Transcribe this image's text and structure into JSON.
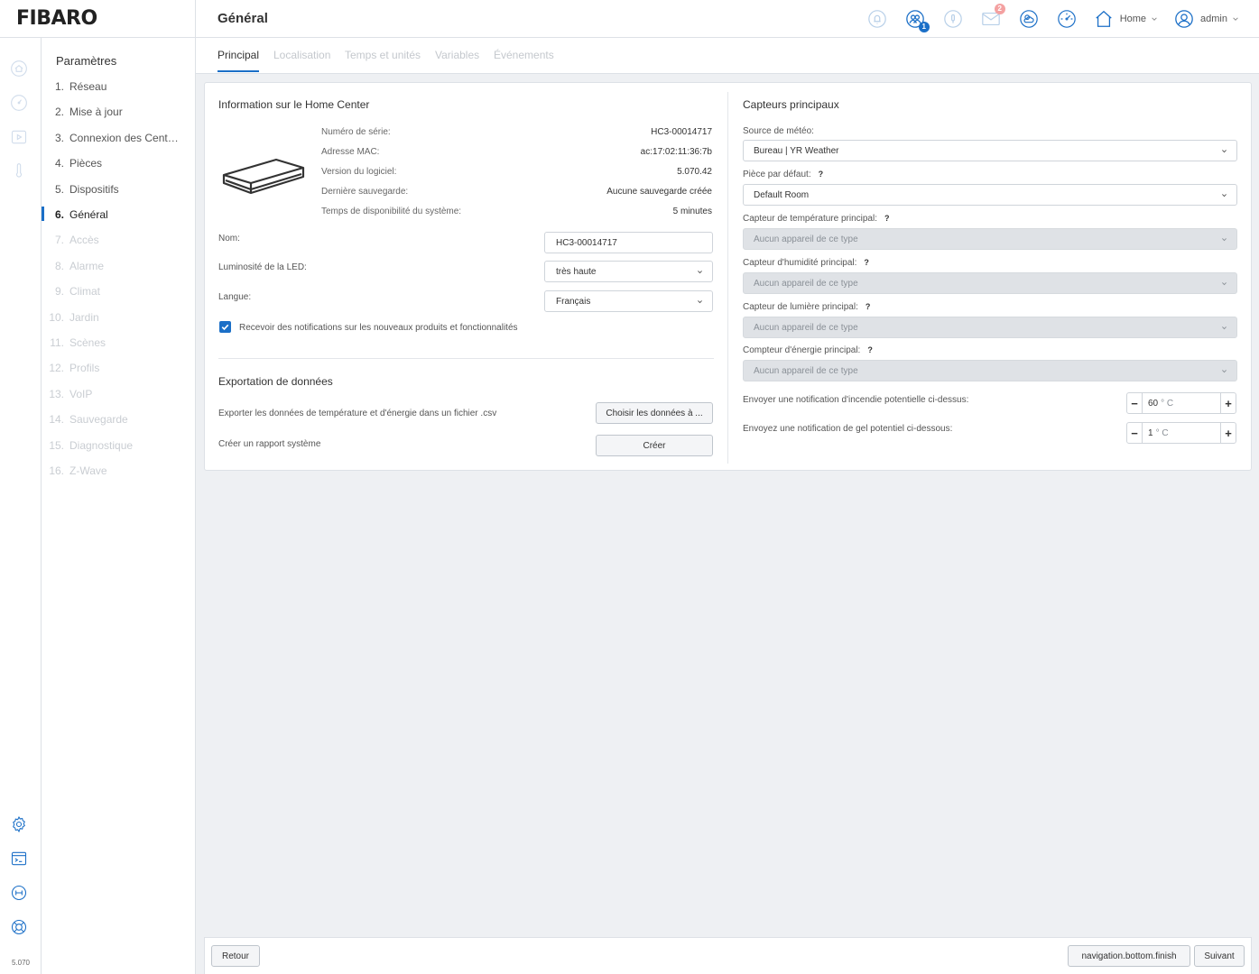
{
  "app": {
    "logo": "FIBARO",
    "version": "5.070"
  },
  "header": {
    "title": "Général",
    "notifications_count": "1",
    "messages_count": "2",
    "home_label": "Home",
    "user_label": "admin"
  },
  "sidebar": {
    "title": "Paramètres",
    "items": [
      {
        "num": "1.",
        "label": "Réseau",
        "state": "enabled"
      },
      {
        "num": "2.",
        "label": "Mise à jour",
        "state": "enabled"
      },
      {
        "num": "3.",
        "label": "Connexion des Centrales",
        "state": "enabled"
      },
      {
        "num": "4.",
        "label": "Pièces",
        "state": "enabled"
      },
      {
        "num": "5.",
        "label": "Dispositifs",
        "state": "enabled"
      },
      {
        "num": "6.",
        "label": "Général",
        "state": "active"
      },
      {
        "num": "7.",
        "label": "Accès",
        "state": "disabled"
      },
      {
        "num": "8.",
        "label": "Alarme",
        "state": "disabled"
      },
      {
        "num": "9.",
        "label": "Climat",
        "state": "disabled"
      },
      {
        "num": "10.",
        "label": "Jardin",
        "state": "disabled"
      },
      {
        "num": "11.",
        "label": "Scènes",
        "state": "disabled"
      },
      {
        "num": "12.",
        "label": "Profils",
        "state": "disabled"
      },
      {
        "num": "13.",
        "label": "VoIP",
        "state": "disabled"
      },
      {
        "num": "14.",
        "label": "Sauvegarde",
        "state": "disabled"
      },
      {
        "num": "15.",
        "label": "Diagnostique",
        "state": "disabled"
      },
      {
        "num": "16.",
        "label": "Z-Wave",
        "state": "disabled"
      }
    ]
  },
  "tabs": [
    {
      "label": "Principal",
      "active": true
    },
    {
      "label": "Localisation",
      "active": false
    },
    {
      "label": "Temps et unités",
      "active": false
    },
    {
      "label": "Variables",
      "active": false
    },
    {
      "label": "Événements",
      "active": false
    }
  ],
  "info": {
    "title": "Information sur le Home Center",
    "rows": [
      {
        "label": "Numéro de série:",
        "value": "HC3-00014717"
      },
      {
        "label": "Adresse MAC:",
        "value": "ac:17:02:11:36:7b"
      },
      {
        "label": "Version du logiciel:",
        "value": "5.070.42"
      },
      {
        "label": "Dernière sauvegarde:",
        "value": "Aucune sauvegarde créée"
      },
      {
        "label": "Temps de disponibilité du système:",
        "value": "5 minutes"
      }
    ]
  },
  "form": {
    "name_label": "Nom:",
    "name_value": "HC3-00014717",
    "led_label": "Luminosité de la LED:",
    "led_value": "très haute",
    "lang_label": "Langue:",
    "lang_value": "Français",
    "notify_label": "Recevoir des notifications sur les nouveaux produits et fonctionnalités",
    "notify_checked": true
  },
  "export": {
    "title": "Exportation de données",
    "csv_label": "Exporter les données de température et d'énergie dans un fichier .csv",
    "csv_button": "Choisir les données à ...",
    "report_label": "Créer un rapport système",
    "report_button": "Créer"
  },
  "sensors": {
    "title": "Capteurs principaux",
    "weather_label": "Source de météo:",
    "weather_value": "Bureau | YR Weather",
    "room_label": "Pièce par défaut:",
    "room_value": "Default Room",
    "temp_label": "Capteur de température principal:",
    "temp_value": "Aucun appareil de ce type",
    "humidity_label": "Capteur d'humidité principal:",
    "humidity_value": "Aucun appareil de ce type",
    "light_label": "Capteur de lumière principal:",
    "light_value": "Aucun appareil de ce type",
    "energy_label": "Compteur d'énergie principal:",
    "energy_value": "Aucun appareil de ce type",
    "help_mark": "?",
    "fire_label": "Envoyer une notification d'incendie potentielle ci-dessus:",
    "fire_value": "60",
    "frost_label": "Envoyez une notification de gel potentiel ci-dessous:",
    "frost_value": "1",
    "unit": "° C",
    "minus": "−",
    "plus": "+"
  },
  "footer": {
    "back_button": "Retour",
    "finish_button": "navigation.bottom.finish",
    "next_button": "Suivant"
  },
  "colors": {
    "accent": "#1b6fc7",
    "disabled_text": "#c9cdd2",
    "background": "#eef0f3"
  }
}
